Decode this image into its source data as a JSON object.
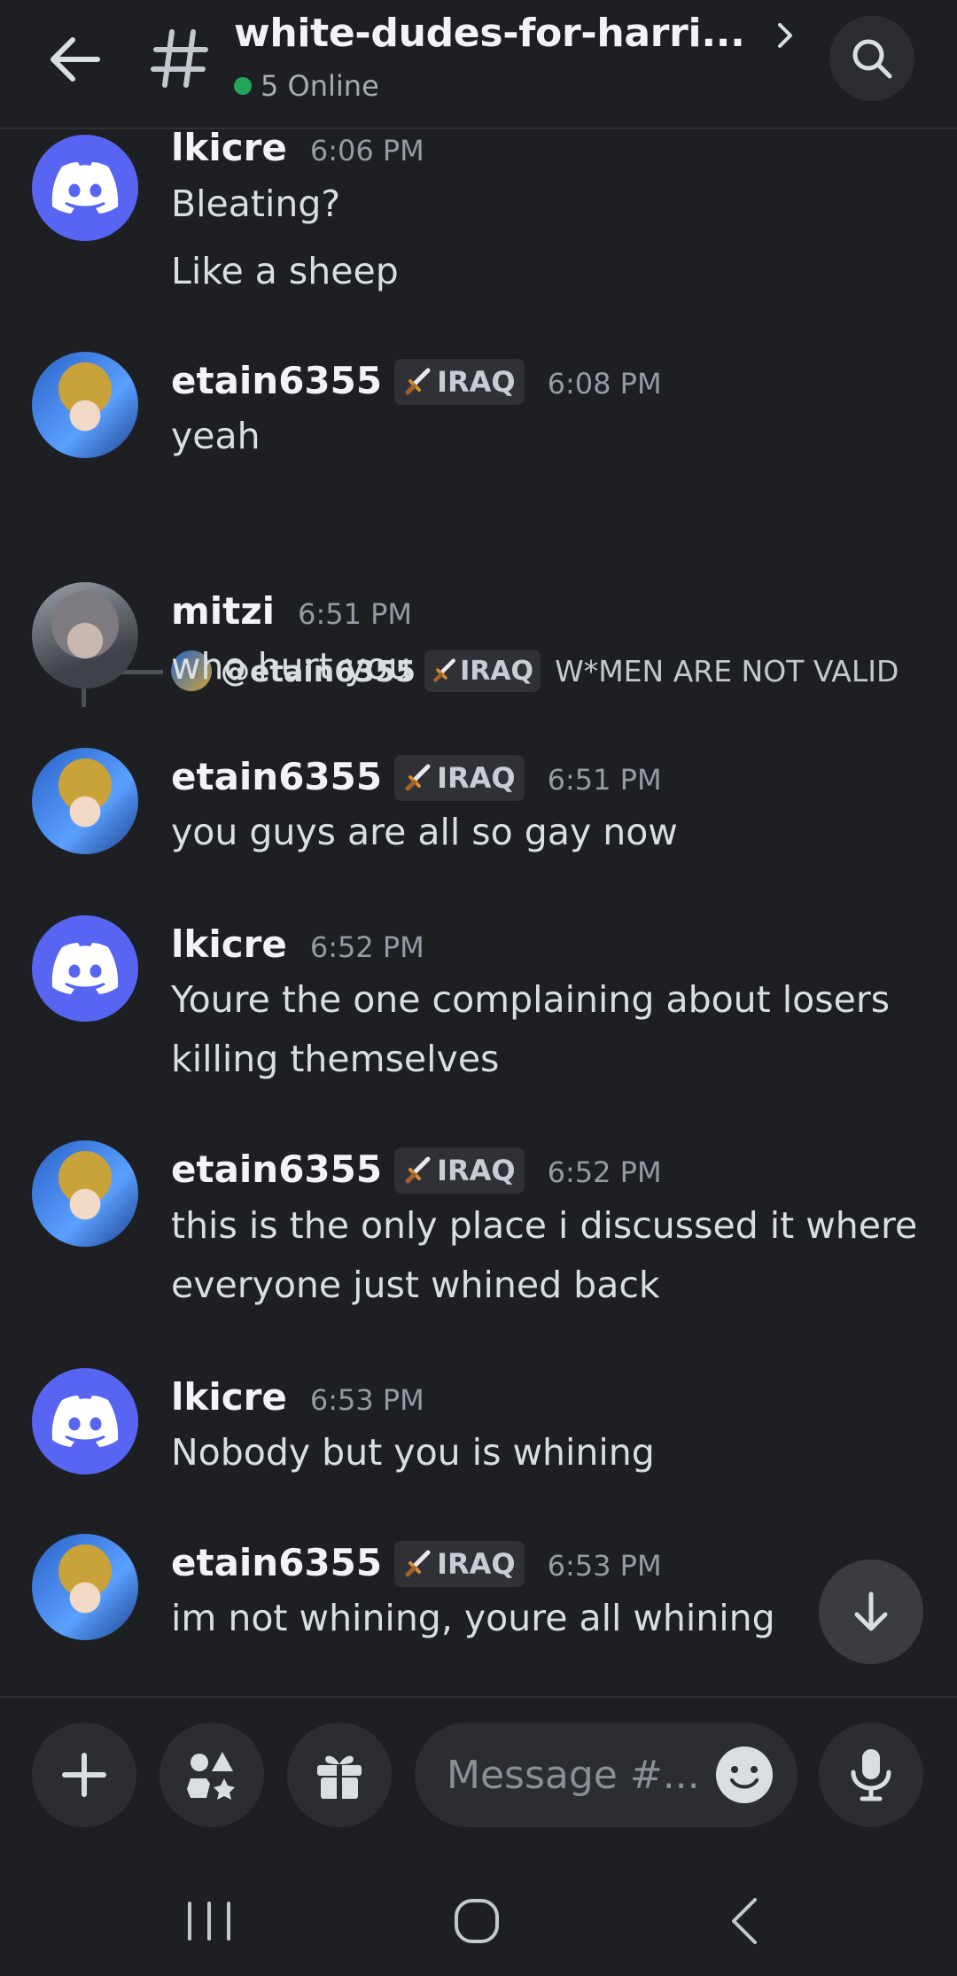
{
  "header": {
    "channel_name": "white-dudes-for-harri...",
    "online_text": "5 Online"
  },
  "role": {
    "label": "IRAQ"
  },
  "messages": [
    {
      "user": "lkicre",
      "time": "6:06 PM",
      "lines": [
        "Bleating?",
        "Like a sheep"
      ]
    },
    {
      "user": "etain6355",
      "time": "6:08 PM",
      "lines": [
        "yeah"
      ]
    },
    {
      "user": "mitzi",
      "time": "6:51 PM",
      "lines": [
        "who hurt you"
      ],
      "reply": {
        "user": "@etain6355",
        "text": "W*MEN ARE NOT VALID"
      }
    },
    {
      "user": "etain6355",
      "time": "6:51 PM",
      "lines": [
        "you guys are all so gay now"
      ]
    },
    {
      "user": "lkicre",
      "time": "6:52 PM",
      "lines": [
        "Youre the one complaining about losers",
        "killing themselves"
      ]
    },
    {
      "user": "etain6355",
      "time": "6:52 PM",
      "lines": [
        "this is the only place i discussed it where",
        "everyone just whined back"
      ]
    },
    {
      "user": "lkicre",
      "time": "6:53 PM",
      "lines": [
        "Nobody but you is whining"
      ]
    },
    {
      "user": "etain6355",
      "time": "6:53 PM",
      "lines": [
        "im not whining, youre all whining"
      ]
    }
  ],
  "composer": {
    "placeholder": "Message #..."
  },
  "colors": {
    "background": "#1e1f23",
    "blurple": "#5865f2",
    "online": "#23a55a"
  }
}
